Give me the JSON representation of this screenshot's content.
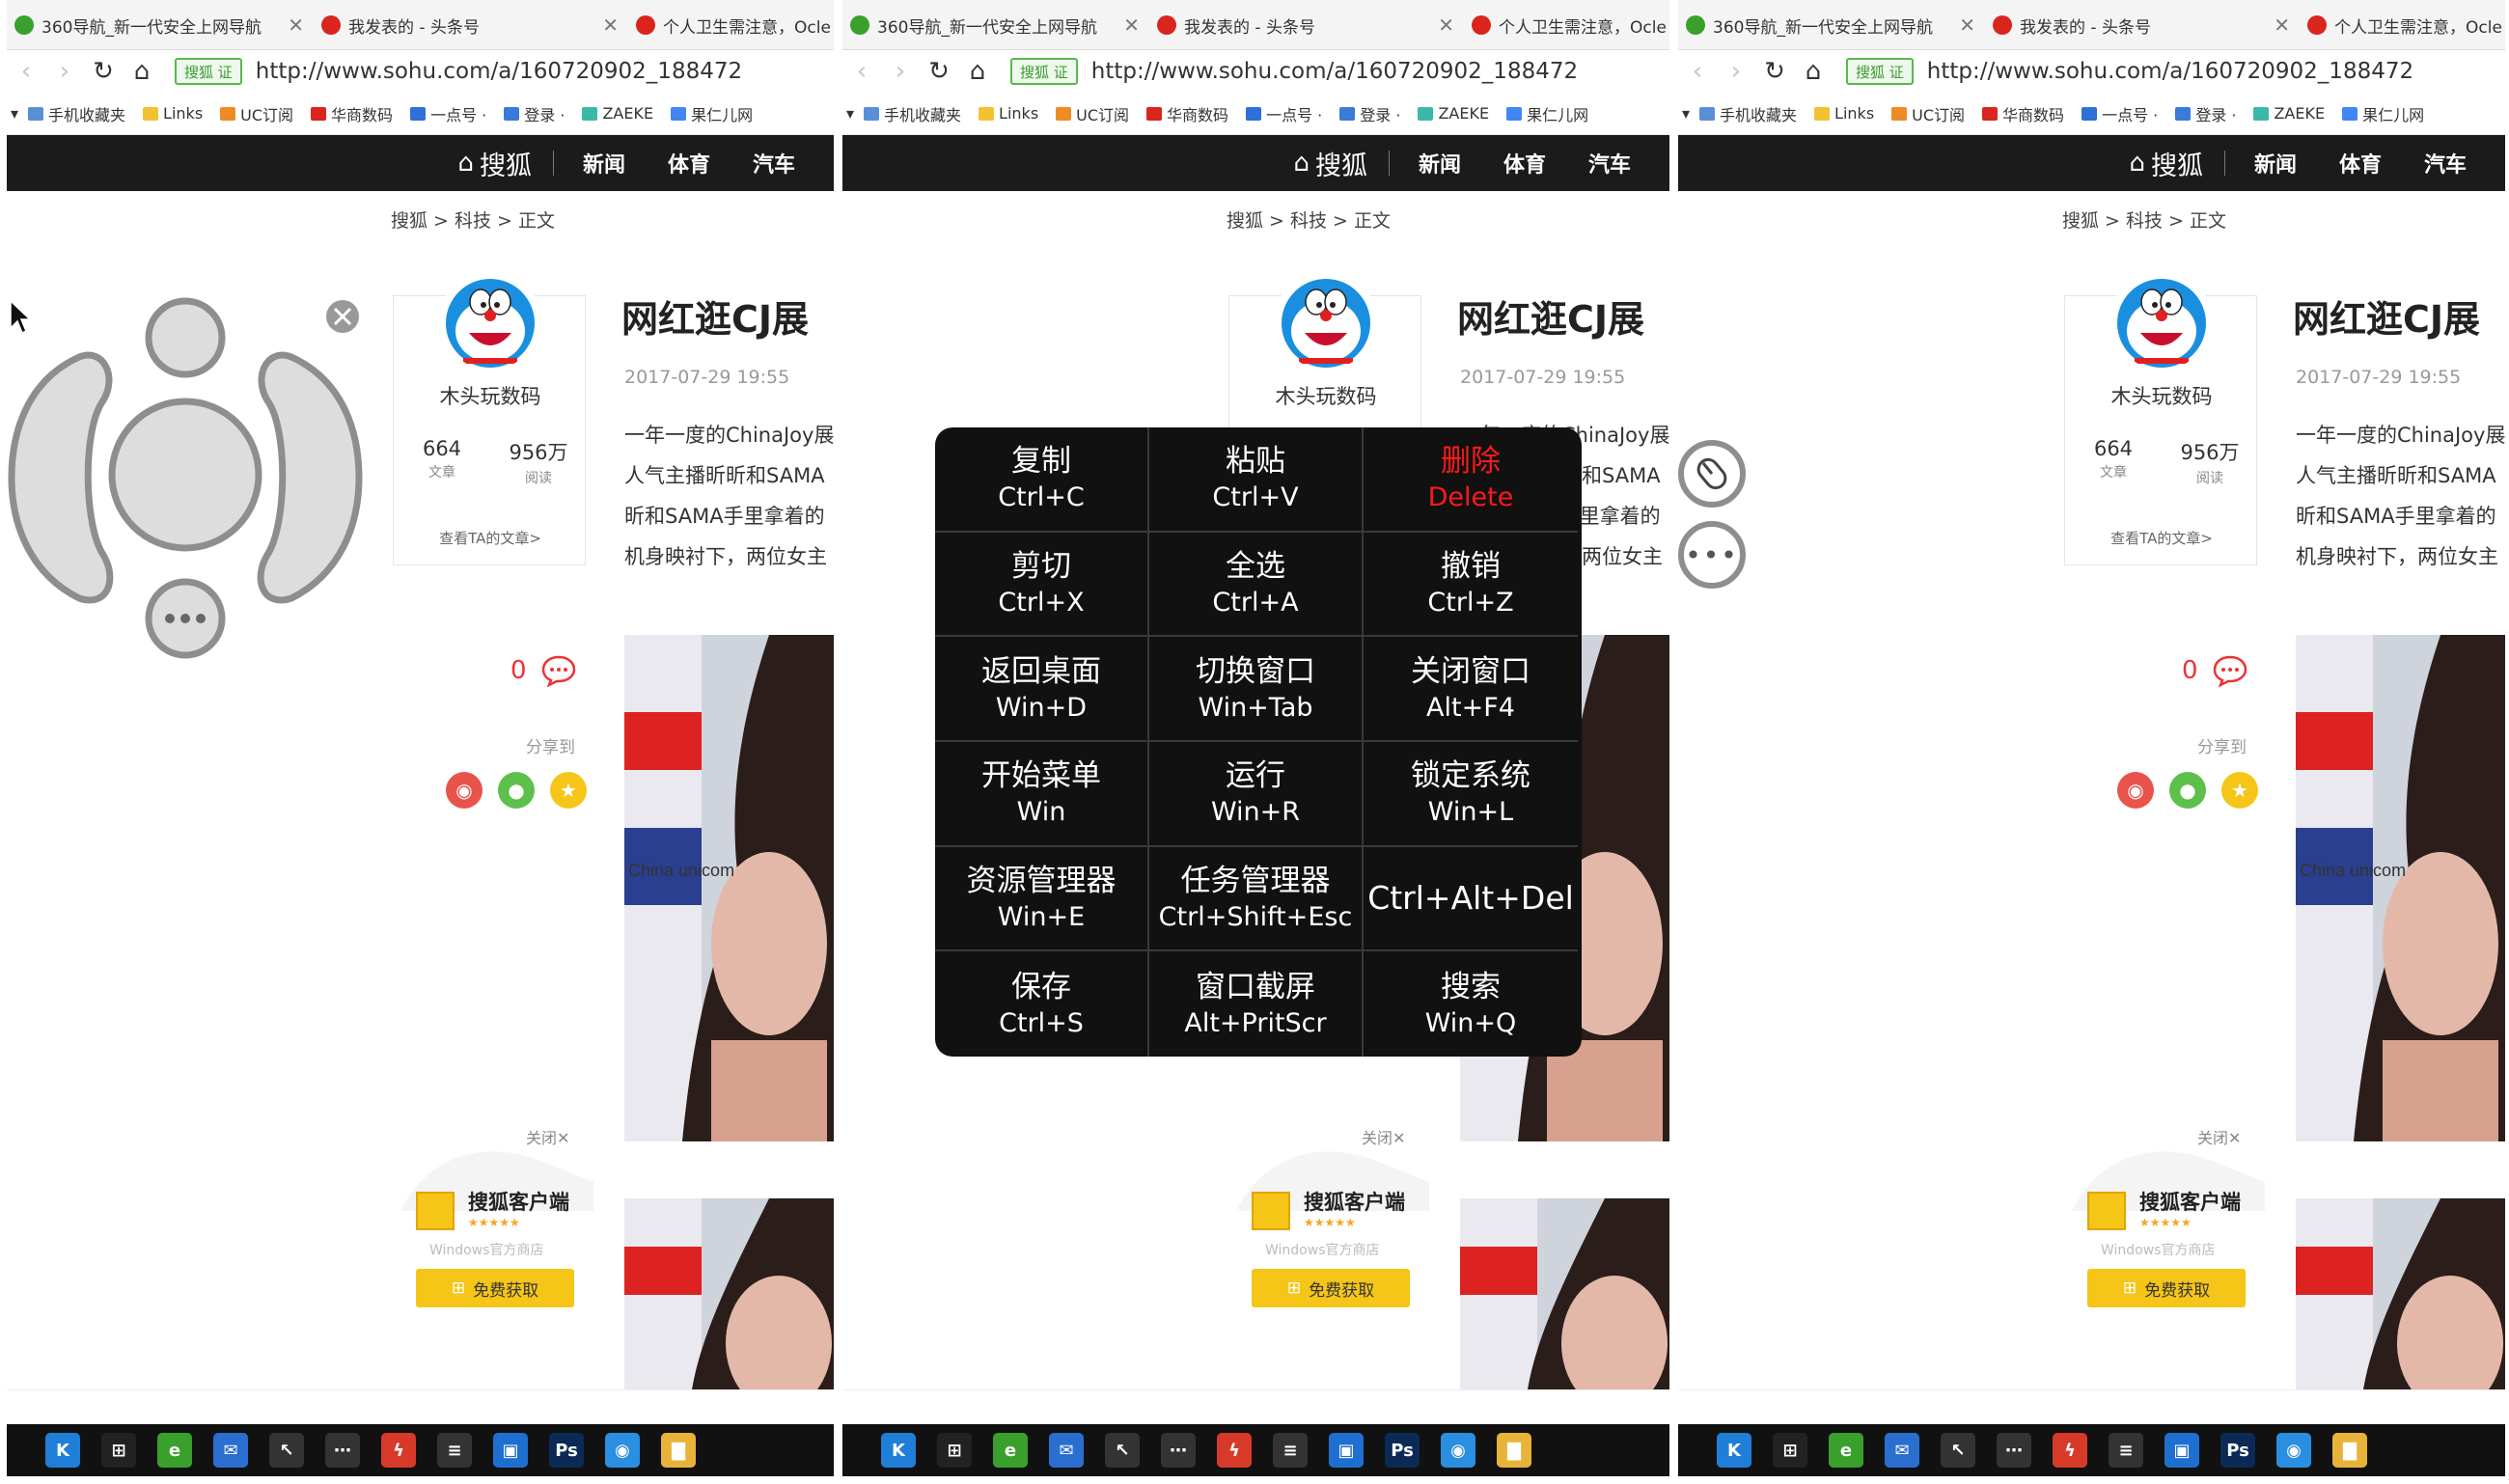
{
  "browser": {
    "tabs": [
      {
        "title": "360导航_新一代安全上网导航",
        "fav_color": "#3aa02c"
      },
      {
        "title": "我发表的 - 头条号",
        "fav_color": "#d9251d"
      },
      {
        "title": "个人卫生需注意，Ocle",
        "fav_color": "#d9251d"
      }
    ],
    "security_badge": "搜狐 证",
    "url": "http://www.sohu.com/a/160720902_188472",
    "bookmarks": [
      {
        "label": "手机收藏夹",
        "color": "#5a8fd8"
      },
      {
        "label": "Links",
        "color": "#f2c230"
      },
      {
        "label": "UC订阅",
        "color": "#f08a24"
      },
      {
        "label": "华商数码",
        "color": "#d9251d"
      },
      {
        "label": "一点号 ·",
        "color": "#2f6fd8"
      },
      {
        "label": "登录 ·",
        "color": "#3a7ad8"
      },
      {
        "label": "ZAEKE",
        "color": "#3cb8a8"
      },
      {
        "label": "果仁儿网",
        "color": "#4285f4"
      }
    ]
  },
  "site": {
    "logo": "搜狐",
    "nav": [
      "新闻",
      "体育",
      "汽车"
    ],
    "breadcrumb": "搜狐 > 科技 > 正文",
    "author": {
      "name": "木头玩数码",
      "articles": "664",
      "articles_label": "文章",
      "reads": "956万",
      "reads_label": "阅读",
      "see_all": "查看TA的文章>"
    },
    "article": {
      "title": "网红逛CJ展",
      "date": "2017-07-29 19:55",
      "lines": [
        "一年一度的ChinaJoy展",
        "人气主播昕昕和SAMA",
        "昕和SAMA手里拿着的",
        "机身映衬下，两位女主"
      ]
    },
    "comment_count": "0",
    "share_label": "分享到",
    "ad": {
      "close": "关闭✕",
      "title": "搜狐客户端",
      "store": "Windows官方商店",
      "button": "免费获取"
    },
    "photo_text": "China unicom"
  },
  "menu": {
    "items": [
      {
        "name": "复制",
        "key": "Ctrl+C"
      },
      {
        "name": "粘贴",
        "key": "Ctrl+V"
      },
      {
        "name": "删除",
        "key": "Delete",
        "highlight": true
      },
      {
        "name": "剪切",
        "key": "Ctrl+X"
      },
      {
        "name": "全选",
        "key": "Ctrl+A"
      },
      {
        "name": "撤销",
        "key": "Ctrl+Z"
      },
      {
        "name": "返回桌面",
        "key": "Win+D"
      },
      {
        "name": "切换窗口",
        "key": "Win+Tab"
      },
      {
        "name": "关闭窗口",
        "key": "Alt+F4"
      },
      {
        "name": "开始菜单",
        "key": "Win"
      },
      {
        "name": "运行",
        "key": "Win+R"
      },
      {
        "name": "锁定系统",
        "key": "Win+L"
      },
      {
        "name": "资源管理器",
        "key": "Win+E"
      },
      {
        "name": "任务管理器",
        "key": "Ctrl+Shift+Esc"
      },
      {
        "name": "Ctrl+Alt+Del",
        "key": ""
      },
      {
        "name": "保存",
        "key": "Ctrl+S"
      },
      {
        "name": "窗口截屏",
        "key": "Alt+PritScr"
      },
      {
        "name": "搜索",
        "key": "Win+Q"
      }
    ]
  },
  "taskbar": {
    "icons": [
      {
        "icon": "kugou-icon",
        "color": "#1f7fd8",
        "glyph": "K"
      },
      {
        "icon": "store-icon",
        "color": "#222",
        "glyph": "⊞"
      },
      {
        "icon": "browser-360-icon",
        "color": "#3aa02c",
        "glyph": "e"
      },
      {
        "icon": "mail-icon",
        "color": "#2a6fd0",
        "glyph": "✉"
      },
      {
        "icon": "pointer-icon",
        "color": "#333",
        "glyph": "↖"
      },
      {
        "icon": "apps-icon",
        "color": "#333",
        "glyph": "⋯"
      },
      {
        "icon": "flash-icon",
        "color": "#d83a2a",
        "glyph": "ϟ"
      },
      {
        "icon": "list-icon",
        "color": "#333",
        "glyph": "≡"
      },
      {
        "icon": "window-icon",
        "color": "#1f6fd0",
        "glyph": "▣"
      },
      {
        "icon": "photoshop-icon",
        "color": "#0b2a56",
        "glyph": "Ps"
      },
      {
        "icon": "media-icon",
        "color": "#2a8fe0",
        "glyph": "◉"
      },
      {
        "icon": "folder-icon",
        "color": "#e9b33a",
        "glyph": "▇"
      }
    ]
  }
}
